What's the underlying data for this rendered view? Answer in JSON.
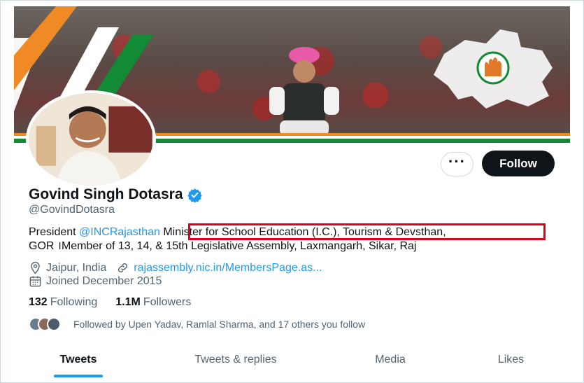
{
  "profile": {
    "display_name": "Govind Singh Dotasra",
    "handle": "@GovindDotasra",
    "bio_prefix": "President ",
    "bio_mention": "@INCRajasthan",
    "bio_highlight": " Minister for School Education (I.C.), Tourism & Devsthan,",
    "bio_line2": "GOR ।Member of 13, 14, & 15th Legislative Assembly, Laxmangarh, Sikar, Raj",
    "location": "Jaipur, India",
    "website": "rajassembly.nic.in/MembersPage.as...",
    "joined": "Joined December 2015"
  },
  "actions": {
    "more_label": "···",
    "follow_label": "Follow"
  },
  "stats": {
    "following_count": "132",
    "following_label": "Following",
    "followers_count": "1.1M",
    "followers_label": "Followers"
  },
  "followed_by": {
    "text": "Followed by Upen Yadav, Ramlal Sharma, and 17 others you follow"
  },
  "tabs": [
    {
      "label": "Tweets",
      "active": true
    },
    {
      "label": "Tweets & replies",
      "active": false
    },
    {
      "label": "Media",
      "active": false
    },
    {
      "label": "Likes",
      "active": false
    }
  ],
  "icons": {
    "verified": "verified-badge-icon",
    "location": "location-pin-icon",
    "link": "link-icon",
    "calendar": "calendar-icon",
    "more": "more-icon"
  },
  "colors": {
    "accent": "#1d9bf0",
    "highlight_box": "#e0001b",
    "text_primary": "#0f1419",
    "text_secondary": "#536471",
    "saffron": "#f08a24",
    "green": "#138a36"
  }
}
